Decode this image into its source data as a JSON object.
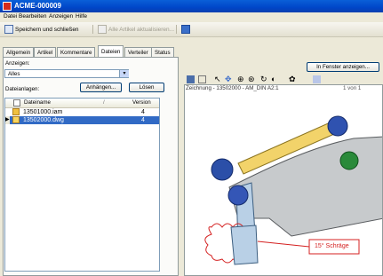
{
  "window": {
    "title": "ACME-000009"
  },
  "menu": [
    "Datei",
    "Bearbeiten",
    "Anzeigen",
    "Hilfe"
  ],
  "toolbar": {
    "save_close": "Speichern und schließen",
    "update_all": "Alle Artikel aktualisieren..."
  },
  "tabs": [
    "Allgemein",
    "Artikel",
    "Kommentare",
    "Dateien",
    "Verteiler",
    "Status"
  ],
  "active_tab": "Dateien",
  "files_panel": {
    "show_label": "Anzeigen:",
    "show_value": "Alles",
    "attachments_label": "Dateianlagen:",
    "attach_button": "Anhängen...",
    "delete_button": "Lösen",
    "columns": {
      "name": "Dateiname",
      "version": "Version"
    },
    "rows": [
      {
        "name": "13501000.iam",
        "version": "4",
        "selected": false
      },
      {
        "name": "13502000.dwg",
        "version": "4",
        "selected": true
      }
    ]
  },
  "viewer": {
    "open_window_button": "In Fenster anzeigen...",
    "drawing_title": "Zeichnung - 13502000 - AM_DIN A2:1",
    "page_of": "1 von 1",
    "annotation": "15° Schräge"
  }
}
